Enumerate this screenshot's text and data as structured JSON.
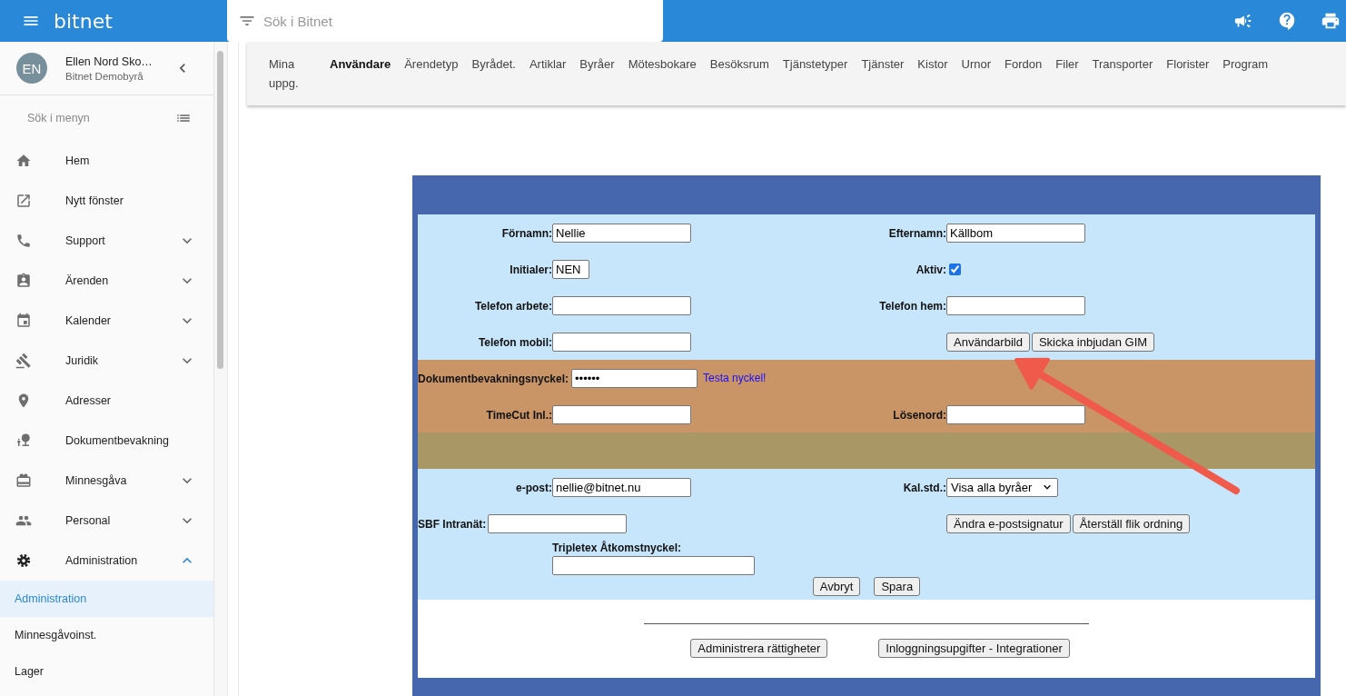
{
  "app_bar": {
    "logo": "bitnet",
    "search": {
      "placeholder": "Sök i Bitnet"
    }
  },
  "sidebar": {
    "profile": {
      "initials": "EN",
      "name": "Ellen Nord Sko…",
      "organization": "Bitnet Demobyrå"
    },
    "search": {
      "placeholder": "Sök i menyn"
    },
    "items": [
      {
        "label": "Hem",
        "kind": "link"
      },
      {
        "label": "Nytt fönster",
        "kind": "link"
      },
      {
        "label": "Support",
        "kind": "group",
        "expanded": false
      },
      {
        "label": "Ärenden",
        "kind": "group",
        "expanded": false
      },
      {
        "label": "Kalender",
        "kind": "group",
        "expanded": false
      },
      {
        "label": "Juridik",
        "kind": "group",
        "expanded": false
      },
      {
        "label": "Adresser",
        "kind": "link"
      },
      {
        "label": "Dokumentbevakning",
        "kind": "link"
      },
      {
        "label": "Minnesgåva",
        "kind": "group",
        "expanded": false
      },
      {
        "label": "Personal",
        "kind": "group",
        "expanded": false
      },
      {
        "label": "Administration",
        "kind": "group",
        "expanded": true
      }
    ],
    "sub_items": [
      {
        "label": "Administration",
        "selected": true
      },
      {
        "label": "Minnesgåvoinst.",
        "selected": false
      },
      {
        "label": "Lager",
        "selected": false
      }
    ]
  },
  "tabs": [
    {
      "label": "Mina uppg.",
      "selected": false
    },
    {
      "label": "Användare",
      "selected": true
    },
    {
      "label": "Ärendetyp",
      "selected": false
    },
    {
      "label": "Byrådet.",
      "selected": false
    },
    {
      "label": "Artiklar",
      "selected": false
    },
    {
      "label": "Byråer",
      "selected": false
    },
    {
      "label": "Mötesbokare",
      "selected": false
    },
    {
      "label": "Besöksrum",
      "selected": false
    },
    {
      "label": "Tjänstetyper",
      "selected": false
    },
    {
      "label": "Tjänster",
      "selected": false
    },
    {
      "label": "Kistor",
      "selected": false
    },
    {
      "label": "Urnor",
      "selected": false
    },
    {
      "label": "Fordon",
      "selected": false
    },
    {
      "label": "Filer",
      "selected": false
    },
    {
      "label": "Transporter",
      "selected": false
    },
    {
      "label": "Florister",
      "selected": false
    },
    {
      "label": "Program",
      "selected": false
    }
  ],
  "form": {
    "sections": [
      {
        "color": "#c8e6fb",
        "rows": [
          {
            "kind": "pair",
            "left": {
              "kind": "text",
              "label": "Förnamn:",
              "value": "Nellie"
            },
            "right": {
              "kind": "text",
              "label": "Efternamn:",
              "value": "Källbom"
            }
          },
          {
            "kind": "pair",
            "left": {
              "kind": "short_text",
              "label": "Initialer:",
              "value": "NEN"
            },
            "right": {
              "kind": "checkbox",
              "label": "Aktiv:",
              "checked": true
            }
          },
          {
            "kind": "pair",
            "left": {
              "kind": "text",
              "label": "Telefon arbete:"
            },
            "right": {
              "kind": "text",
              "label": "Telefon hem:"
            }
          },
          {
            "kind": "pair",
            "left": {
              "kind": "text",
              "label": "Telefon mobil:"
            },
            "right": {
              "kind": "buttons",
              "buttons": [
                "Användarbild",
                "Skicka inbjudan GIM"
              ]
            }
          }
        ]
      },
      {
        "color": "#c99566",
        "rows": [
          {
            "kind": "pair",
            "left": {
              "kind": "password",
              "label": "Dokumentbevakningsnyckel:",
              "value": "••••••",
              "link": "Testa nyckel!"
            }
          },
          {
            "kind": "pair",
            "left": {
              "kind": "text",
              "label": "TimeCut Inl.:"
            },
            "right": {
              "kind": "text",
              "label": "Lösenord:"
            }
          }
        ]
      },
      {
        "color": "#a99766"
      },
      {
        "color": "#c8e6fb",
        "rows": [
          {
            "kind": "pair",
            "left": {
              "kind": "text",
              "label": "e-post:",
              "value": "nellie@bitnet.nu"
            },
            "right": {
              "kind": "select",
              "label": "Kal.std.:",
              "value": "Visa alla byråer"
            }
          },
          {
            "kind": "pair",
            "left": {
              "kind": "inline_text",
              "label": "SBF Intranät:"
            },
            "right": {
              "kind": "buttons",
              "buttons": [
                "Ändra e-postsignatur",
                "Återställ flik ordning"
              ]
            }
          },
          {
            "kind": "stacked",
            "left": {
              "kind": "stacked_text",
              "label": "Tripletex Åtkomstnyckel:"
            }
          },
          {
            "kind": "actions",
            "buttons": [
              "Avbryt",
              "Spara"
            ]
          }
        ]
      }
    ],
    "footer_buttons": [
      "Administrera rättigheter",
      "Inloggningsupgifter - Integrationer"
    ]
  }
}
